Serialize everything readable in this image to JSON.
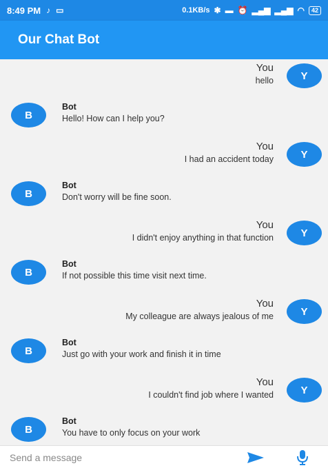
{
  "status_bar": {
    "time": "8:49 PM",
    "net_speed": "0.1KB/s",
    "battery": "42"
  },
  "app_bar": {
    "title": "Our Chat Bot"
  },
  "messages": [
    {
      "sender": "user",
      "name": "You",
      "avatar": "Y",
      "text": "hello"
    },
    {
      "sender": "bot",
      "name": "Bot",
      "avatar": "B",
      "text": "Hello! How can I help you?"
    },
    {
      "sender": "user",
      "name": "You",
      "avatar": "Y",
      "text": "I had an accident today"
    },
    {
      "sender": "bot",
      "name": "Bot",
      "avatar": "B",
      "text": "Don't worry will be fine soon."
    },
    {
      "sender": "user",
      "name": "You",
      "avatar": "Y",
      "text": "I didn't enjoy anything in that function"
    },
    {
      "sender": "bot",
      "name": "Bot",
      "avatar": "B",
      "text": "If not possible this time visit next time."
    },
    {
      "sender": "user",
      "name": "You",
      "avatar": "Y",
      "text": "My colleague are always jealous of me"
    },
    {
      "sender": "bot",
      "name": "Bot",
      "avatar": "B",
      "text": "Just go with your work and finish it in time"
    },
    {
      "sender": "user",
      "name": "You",
      "avatar": "Y",
      "text": "I couldn't find job where I wanted"
    },
    {
      "sender": "bot",
      "name": "Bot",
      "avatar": "B",
      "text": "You have to only focus on your work"
    }
  ],
  "composer": {
    "placeholder": "Send a message",
    "value": "",
    "send_icon": "send-icon",
    "mic_icon": "mic-icon"
  },
  "colors": {
    "primary": "#2196f3",
    "avatar": "#1e88e5",
    "chat_background": "#f2f2f2"
  }
}
